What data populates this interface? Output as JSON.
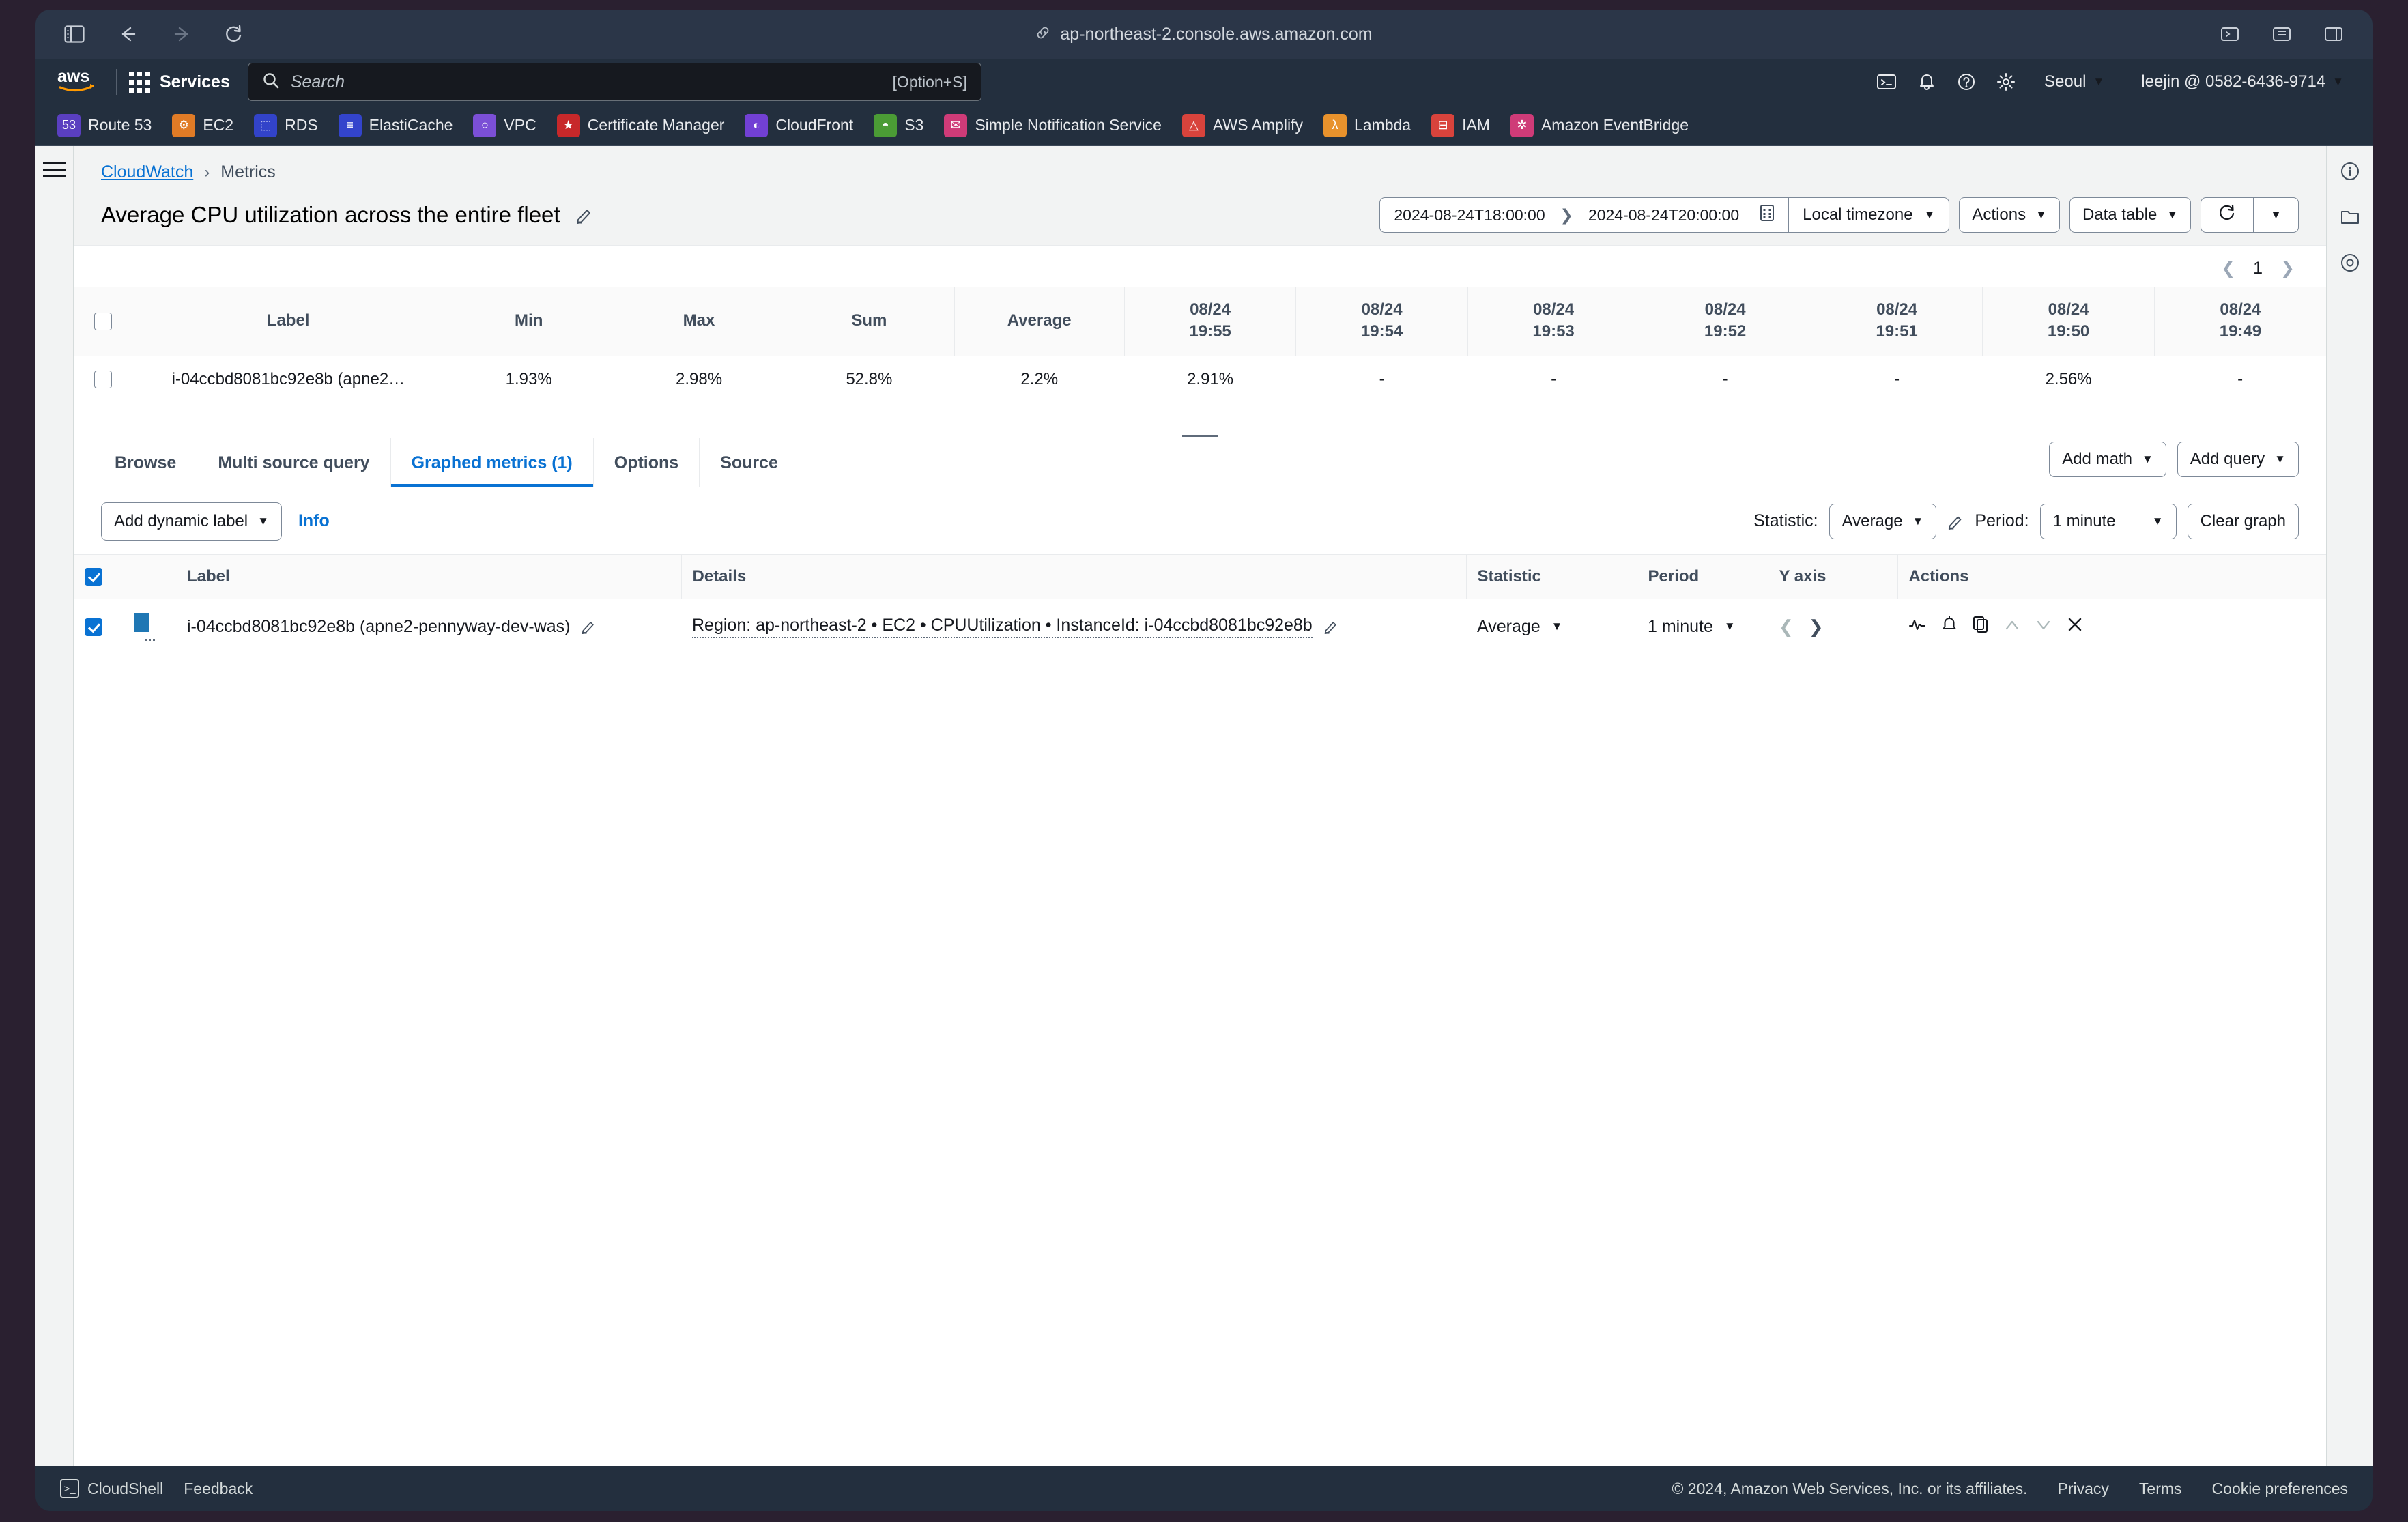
{
  "browser": {
    "url": "ap-northeast-2.console.aws.amazon.com",
    "icons": {
      "sidebar": "sidebar-toggle-icon",
      "back": "back-arrow-icon",
      "forward": "forward-arrow-icon",
      "reload": "reload-icon",
      "lock": "link-icon",
      "extensions": "extensions-icon",
      "share": "share-icon",
      "tabs": "tab-overview-icon"
    }
  },
  "awsnav": {
    "services_label": "Services",
    "search_placeholder": "Search",
    "search_shortcut": "[Option+S]",
    "region": "Seoul",
    "account": "leejin @ 0582-6436-9714",
    "cloudshell_icon": "cloudshell-icon",
    "bell_icon": "notifications-icon",
    "help_icon": "help-icon",
    "settings_icon": "settings-icon"
  },
  "favorites": [
    {
      "label": "Route 53",
      "color": "#5a3fc0",
      "glyph": "53"
    },
    {
      "label": "EC2",
      "color": "#e07b26",
      "glyph": "⚙"
    },
    {
      "label": "RDS",
      "color": "#3243c9",
      "glyph": "⬚"
    },
    {
      "label": "ElastiCache",
      "color": "#3344cc",
      "glyph": "≡"
    },
    {
      "label": "VPC",
      "color": "#7b4fd6",
      "glyph": "○"
    },
    {
      "label": "Certificate Manager",
      "color": "#c7282a",
      "glyph": "★"
    },
    {
      "label": "CloudFront",
      "color": "#7240d4",
      "glyph": "◐"
    },
    {
      "label": "S3",
      "color": "#4b9b35",
      "glyph": "◓"
    },
    {
      "label": "Simple Notification Service",
      "color": "#cf3b78",
      "glyph": "✉"
    },
    {
      "label": "AWS Amplify",
      "color": "#d8433c",
      "glyph": "△"
    },
    {
      "label": "Lambda",
      "color": "#e8922c",
      "glyph": "λ"
    },
    {
      "label": "IAM",
      "color": "#d8433c",
      "glyph": "⊟"
    },
    {
      "label": "Amazon EventBridge",
      "color": "#cf3b78",
      "glyph": "✲"
    }
  ],
  "breadcrumb": {
    "root": "CloudWatch",
    "separator": "›",
    "current": "Metrics"
  },
  "page": {
    "title": "Average CPU utilization across the entire fleet",
    "edit_icon": "pencil-edit-icon"
  },
  "timebar": {
    "start": "2024-08-24T18:00:00",
    "end": "2024-08-24T20:00:00",
    "calendar_icon": "calendar-icon",
    "timezone": "Local timezone",
    "actions": "Actions",
    "view_mode": "Data table",
    "refresh_icon": "refresh-icon",
    "refresh_dropdown_caret": "▼"
  },
  "pagination": {
    "page": "1",
    "prev_icon": "chevron-left-icon",
    "next_icon": "chevron-right-icon"
  },
  "data_table": {
    "columns": [
      "Label",
      "Min",
      "Max",
      "Sum",
      "Average"
    ],
    "time_columns": [
      {
        "date": "08/24",
        "time": "19:55"
      },
      {
        "date": "08/24",
        "time": "19:54"
      },
      {
        "date": "08/24",
        "time": "19:53"
      },
      {
        "date": "08/24",
        "time": "19:52"
      },
      {
        "date": "08/24",
        "time": "19:51"
      },
      {
        "date": "08/24",
        "time": "19:50"
      },
      {
        "date": "08/24",
        "time": "19:49"
      }
    ],
    "rows": [
      {
        "label": "i-04ccbd8081bc92e8b (apne2…",
        "min": "1.93%",
        "max": "2.98%",
        "sum": "52.8%",
        "average": "2.2%",
        "values": [
          "2.91%",
          "-",
          "-",
          "-",
          "-",
          "2.56%",
          "-"
        ]
      }
    ]
  },
  "tabs": [
    {
      "label": "Browse",
      "active": false
    },
    {
      "label": "Multi source query",
      "active": false
    },
    {
      "label": "Graphed metrics (1)",
      "active": true
    },
    {
      "label": "Options",
      "active": false
    },
    {
      "label": "Source",
      "active": false
    }
  ],
  "tab_actions": {
    "add_math": "Add math",
    "add_query": "Add query"
  },
  "graph_toolbar": {
    "add_dynamic_label": "Add dynamic label",
    "info": "Info",
    "statistic_label": "Statistic:",
    "statistic_value": "Average",
    "period_label": "Period:",
    "period_value": "1 minute",
    "clear_graph": "Clear graph",
    "pencil_icon": "pencil-edit-icon"
  },
  "graphed_metrics": {
    "columns": [
      "Label",
      "Details",
      "Statistic",
      "Period",
      "Y axis",
      "Actions"
    ],
    "rows": [
      {
        "label": "i-04ccbd8081bc92e8b (apne2-pennyway-dev-was)",
        "details": "Region: ap-northeast-2 • EC2 • CPUUtilization • InstanceId: i-04ccbd8081bc92e8b",
        "statistic": "Average",
        "period": "1 minute",
        "color": "#1f77b4",
        "actions": [
          "anomaly-detection-icon",
          "alarm-bell-icon",
          "duplicate-icon",
          "move-up-icon",
          "move-down-icon",
          "remove-icon"
        ]
      }
    ]
  },
  "footer": {
    "cloudshell": "CloudShell",
    "feedback": "Feedback",
    "copyright": "© 2024, Amazon Web Services, Inc. or its affiliates.",
    "privacy": "Privacy",
    "terms": "Terms",
    "cookies": "Cookie preferences"
  },
  "colors": {
    "accent": "#0972d3",
    "nav_bg": "#232f3e",
    "page_bg": "#f2f3f3",
    "series": "#1f77b4"
  }
}
